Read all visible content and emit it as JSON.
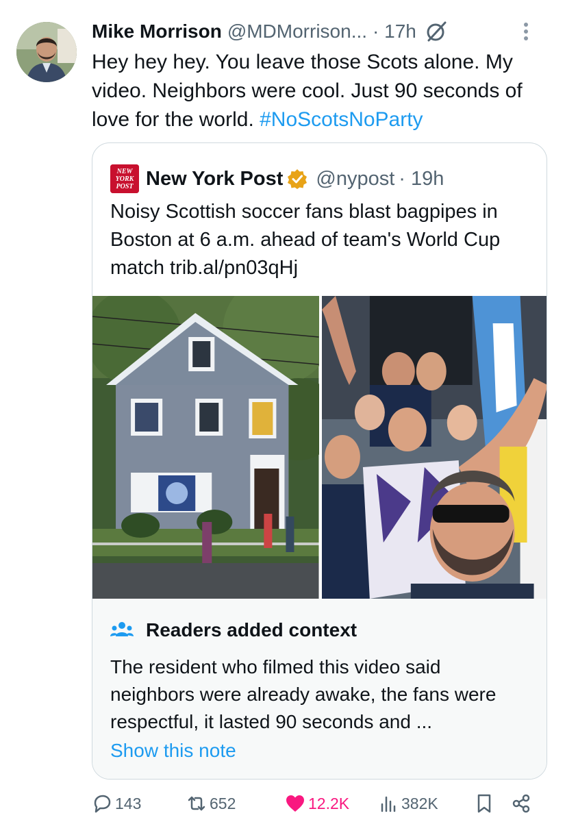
{
  "post": {
    "author_name": "Mike Morrison",
    "author_handle": "@MDMorrison...",
    "time": "· 17h",
    "text": "Hey hey hey. You leave those Scots alone. My video. Neighbors were cool. Just 90 seconds of love for the world.",
    "hashtag": "#NoScotsNoParty",
    "icons": [
      "grok-icon",
      "more-icon"
    ]
  },
  "quote": {
    "logo_text": [
      "NEW",
      "YORK",
      "POST"
    ],
    "author_name": "New York Post",
    "author_handle": "@nypost",
    "time": "· 19h",
    "text": "Noisy Scottish soccer fans blast bagpipes in Boston at 6 a.m. ahead of team's World Cup match trib.al/pn03qHj",
    "accent_logo": "#c8102e",
    "verified_color": "#e8a317"
  },
  "context": {
    "title": "Readers added context",
    "text": "The resident who filmed this video said neighbors were already awake, the fans were respectful, it lasted 90 seconds and ...",
    "link": "Show this note"
  },
  "actions": {
    "replies": "143",
    "reposts": "652",
    "likes": "12.2K",
    "views": "382K"
  },
  "colors": {
    "link": "#1d9bf0",
    "like": "#f91880",
    "muted": "#536471"
  }
}
